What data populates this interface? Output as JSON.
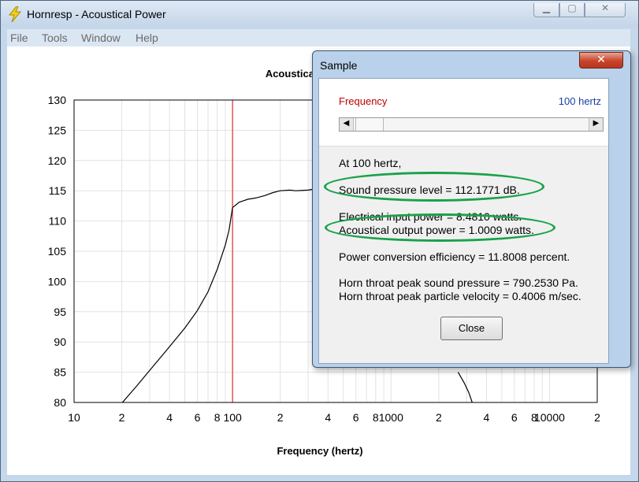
{
  "window": {
    "title": "Hornresp - Acoustical Power",
    "controls": {
      "minimize": "▁",
      "maximize": "▢",
      "close": "✕"
    }
  },
  "menu": [
    "File",
    "Tools",
    "Window",
    "Help"
  ],
  "chart_data": {
    "type": "line",
    "title": "Acoustical Power",
    "xlabel": "Frequency (hertz)",
    "ylabel": "",
    "x_scale": "log",
    "xlim": [
      10,
      20000
    ],
    "ylim": [
      80,
      130
    ],
    "yticks": [
      130,
      125,
      120,
      115,
      110,
      105,
      100,
      95,
      90,
      85,
      80
    ],
    "xtick_labels": [
      {
        "value": 10,
        "label": "10"
      },
      {
        "value": 20,
        "label": "2"
      },
      {
        "value": 40,
        "label": "4"
      },
      {
        "value": 60,
        "label": "6"
      },
      {
        "value": 80,
        "label": "8"
      },
      {
        "value": 100,
        "label": "100"
      },
      {
        "value": 200,
        "label": "2"
      },
      {
        "value": 400,
        "label": "4"
      },
      {
        "value": 600,
        "label": "6"
      },
      {
        "value": 800,
        "label": "8"
      },
      {
        "value": 1000,
        "label": "1000"
      },
      {
        "value": 2000,
        "label": "2"
      },
      {
        "value": 4000,
        "label": "4"
      },
      {
        "value": 6000,
        "label": "6"
      },
      {
        "value": 8000,
        "label": "8"
      },
      {
        "value": 10000,
        "label": "10000"
      },
      {
        "value": 20000,
        "label": "2"
      }
    ],
    "grid": true,
    "marker_frequency": 100,
    "marker_color": "#e03030",
    "series": [
      {
        "color": "#000000",
        "x": [
          20.2,
          25,
          30,
          40,
          50,
          60,
          70,
          80,
          90,
          95,
          100,
          110,
          125,
          140,
          160,
          180,
          200,
          230,
          250,
          300,
          330
        ],
        "y": [
          80,
          82.8,
          85.3,
          89.2,
          92.3,
          95.2,
          98.3,
          102.0,
          106.0,
          108.5,
          112.2,
          113.1,
          113.6,
          113.8,
          114.2,
          114.7,
          115.0,
          115.1,
          115.0,
          115.1,
          115.3
        ]
      },
      {
        "color": "#000000",
        "x": [
          2650,
          2900,
          3100,
          3250
        ],
        "y": [
          85.0,
          83.2,
          81.6,
          80.0
        ]
      }
    ]
  },
  "dialog": {
    "title": "Sample",
    "close_glyph": "✕",
    "frequency_label": "Frequency",
    "frequency_value": "100 hertz",
    "slider_fraction": 0.01,
    "lines": {
      "at": "At 100 hertz,",
      "spl": "Sound pressure level = 112.1771 dB.",
      "electrical": "Electrical input power = 8.4810 watts.",
      "acoustical": "Acoustical output power = 1.0009 watts.",
      "efficiency": "Power conversion efficiency = 11.8008 percent.",
      "throat_pressure": "Horn throat peak sound pressure = 790.2530 Pa.",
      "throat_velocity": "Horn throat peak particle velocity = 0.4006 m/sec."
    },
    "close_button": "Close",
    "highlight_color": "#19a24a"
  }
}
